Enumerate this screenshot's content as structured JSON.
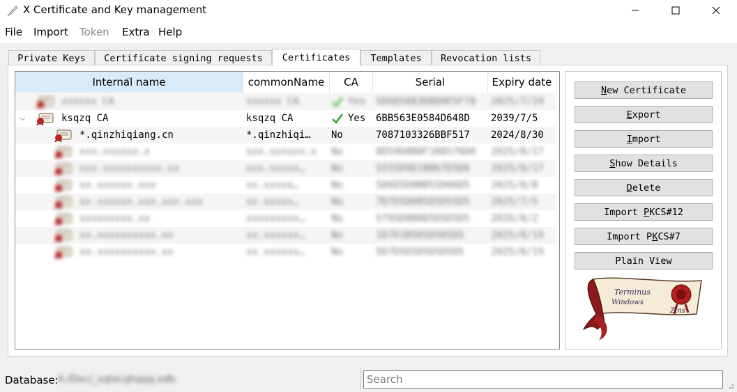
{
  "window": {
    "title": "X Certificate and Key management",
    "icon": "pen-icon"
  },
  "menu": [
    "File",
    "Import",
    "Token",
    "Extra",
    "Help"
  ],
  "menu_disabled": [
    "Token"
  ],
  "tabs": [
    "Private Keys",
    "Certificate signing requests",
    "Certificates",
    "Templates",
    "Revocation lists"
  ],
  "active_tab": "Certificates",
  "columns": [
    "Internal name",
    "commonName",
    "CA",
    "Serial",
    "Expiry date"
  ],
  "sorted_column": "Internal name",
  "rows": [
    {
      "name": "xxxxxx CA",
      "cn": "xxxxxx CA",
      "ca": "Yes",
      "serial": "5D6D5083D8D0E5F78",
      "expiry": "2025/7/19",
      "blurred": true,
      "level": 0,
      "check": true
    },
    {
      "name": "ksqzq CA",
      "cn": "ksqzq CA",
      "ca": "Yes",
      "serial": "6BB563E0584D648D",
      "expiry": "2039/7/5",
      "blurred": false,
      "level": 0,
      "check": true,
      "expanded": true
    },
    {
      "name": "*.qinzhiqiang.cn",
      "cn": "*.qinzhiqi…",
      "ca": "No",
      "serial": "7087103326BBF517",
      "expiry": "2024/8/30",
      "blurred": false,
      "level": 1,
      "check": false
    },
    {
      "name": "xxx.xxxxxx.x",
      "cn": "xxx.xxxxxx.x",
      "ca": "No",
      "serial": "8D59D8B8F1B8576D0",
      "expiry": "2025/8/17",
      "blurred": true,
      "level": 1,
      "check": false
    },
    {
      "name": "xxx.xxxxxxxxxx.xx",
      "cn": "xxx.xxxxx…",
      "ca": "No",
      "serial": "5555D9D1BB67D5D0",
      "expiry": "2025/8/17",
      "blurred": true,
      "level": 1,
      "check": false
    },
    {
      "name": "xx.xxxxxx.xxx",
      "cn": "xx.xxxxx…",
      "ca": "No",
      "serial": "5D6D5D8BB55D06D5",
      "expiry": "2025/8/8",
      "blurred": true,
      "level": 1,
      "check": false
    },
    {
      "name": "xx.xxxxxx.xxx.xxx.xxx",
      "cn": "xx.xxxxx…",
      "ca": "No",
      "serial": "7D7D5D6B5D5D55D5",
      "expiry": "2025/7/5",
      "blurred": true,
      "level": 1,
      "check": false
    },
    {
      "name": "xxxxxxxxx.xx",
      "cn": "xxxxxxxxx…",
      "ca": "No",
      "serial": "5795D8B8D5D5D5D5",
      "expiry": "2026/8/2",
      "blurred": true,
      "level": 1,
      "check": false
    },
    {
      "name": "xx.xxxxxxxxxx.xx",
      "cn": "xx.xxxxxx…",
      "ca": "No",
      "serial": "1D7D1B5D5D5D5D5",
      "expiry": "2025/8/19",
      "blurred": true,
      "level": 1,
      "check": false
    },
    {
      "name": "xx.xxxxxxxxxx.xx",
      "cn": "xx.xxxxxx…",
      "ca": "No",
      "serial": "5D7D5D5D5D5D5D5",
      "expiry": "2025/8/19",
      "blurred": true,
      "level": 1,
      "check": false
    }
  ],
  "buttons": [
    {
      "label": "New Certificate",
      "ul": "N"
    },
    {
      "label": "Export",
      "ul": "E"
    },
    {
      "label": "Import",
      "ul": "I"
    },
    {
      "label": "Show Details",
      "ul": "S"
    },
    {
      "label": "Delete",
      "ul": "D"
    },
    {
      "label": "Import PKCS#12",
      "ul": "P"
    },
    {
      "label": "Import PKCS#7",
      "ul": "K"
    },
    {
      "label": "Plain View",
      "ul": ""
    }
  ],
  "logo": {
    "line1": "Terminus",
    "line2": "Windows",
    "line3": "Zins"
  },
  "status": {
    "db_label": "Database:",
    "db_value": "X:/Doc/_xqlxcqhqqq.xdb",
    "search_placeholder": "Search"
  },
  "colors": {
    "accent": "#d9ebf9",
    "check": "#2aa52a",
    "logo_red": "#9b1b1b"
  }
}
